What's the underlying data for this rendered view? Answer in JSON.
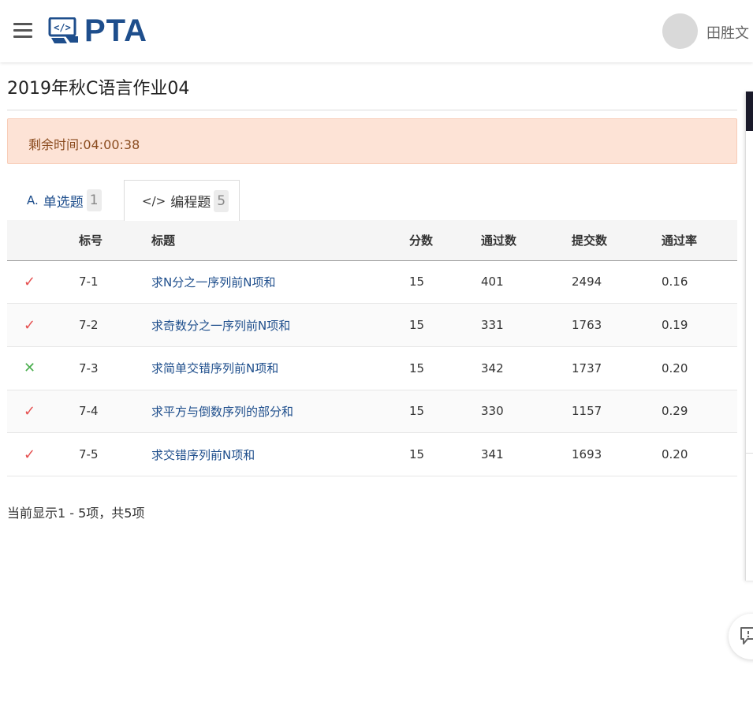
{
  "header": {
    "logo_text": "PTA",
    "user_name": "田胜文"
  },
  "page": {
    "title": "2019年秋C语言作业04",
    "timer": "剩余时间:04:00:38"
  },
  "tabs": [
    {
      "icon": "A.",
      "label": "单选题",
      "count": "1",
      "active": false
    },
    {
      "icon": "</>",
      "label": "编程题",
      "count": "5",
      "active": true
    }
  ],
  "table": {
    "columns": [
      "",
      "标号",
      "标题",
      "分数",
      "通过数",
      "提交数",
      "通过率"
    ],
    "rows": [
      {
        "status": "✓",
        "status_name": "accepted",
        "id": "7-1",
        "title": "求N分之一序列前N项和",
        "score": "15",
        "passed": "401",
        "submitted": "2494",
        "rate": "0.16"
      },
      {
        "status": "✓",
        "status_name": "accepted",
        "id": "7-2",
        "title": "求奇数分之一序列前N项和",
        "score": "15",
        "passed": "331",
        "submitted": "1763",
        "rate": "0.19"
      },
      {
        "status": "✕",
        "status_name": "wrong",
        "id": "7-3",
        "title": "求简单交错序列前N项和",
        "score": "15",
        "passed": "342",
        "submitted": "1737",
        "rate": "0.20"
      },
      {
        "status": "✓",
        "status_name": "accepted",
        "id": "7-4",
        "title": "求平方与倒数序列的部分和",
        "score": "15",
        "passed": "330",
        "submitted": "1157",
        "rate": "0.29"
      },
      {
        "status": "✓",
        "status_name": "accepted",
        "id": "7-5",
        "title": "求交错序列前N项和",
        "score": "15",
        "passed": "341",
        "submitted": "1693",
        "rate": "0.20"
      }
    ]
  },
  "pager": {
    "info": "当前显示1 - 5项，共5项"
  },
  "colors": {
    "brand": "#1e4e8c",
    "accepted": "#e55050",
    "wrong": "#4caf50",
    "timer_bg": "#fde3d6"
  }
}
